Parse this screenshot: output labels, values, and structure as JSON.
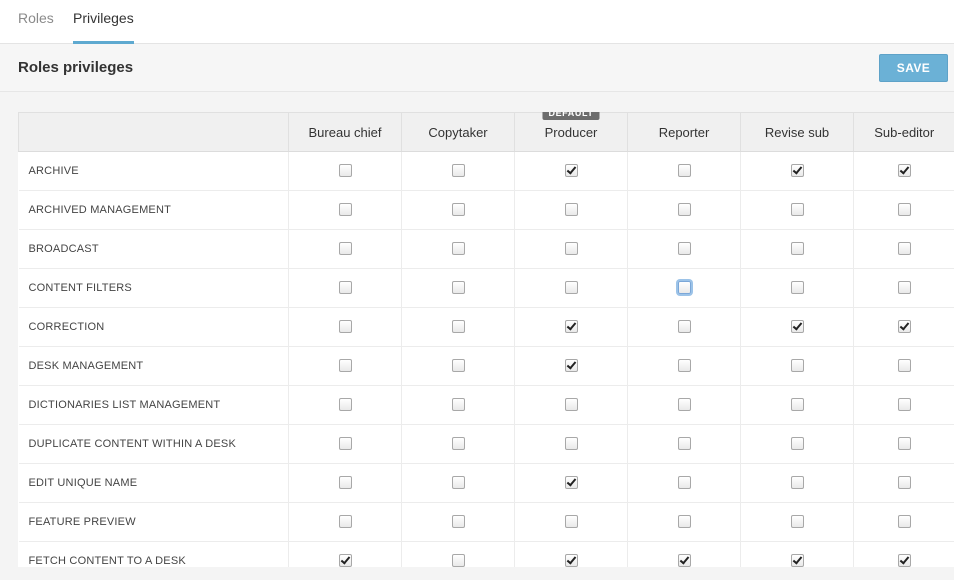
{
  "tabs": [
    {
      "label": "Roles",
      "active": false
    },
    {
      "label": "Privileges",
      "active": true
    }
  ],
  "toolbar": {
    "title": "Roles privileges",
    "save_label": "SAVE"
  },
  "colors": {
    "accent": "#5ea9d0",
    "save_button": "#6bb1d6",
    "badge": "#6d6d6d"
  },
  "table": {
    "default_badge": "DEFAULT",
    "default_role_index": 2,
    "roles": [
      "Bureau chief",
      "Copytaker",
      "Producer",
      "Reporter",
      "Revise sub",
      "Sub-editor"
    ],
    "rows": [
      {
        "name": "ARCHIVE",
        "values": [
          false,
          false,
          true,
          false,
          true,
          true
        ]
      },
      {
        "name": "ARCHIVED MANAGEMENT",
        "values": [
          false,
          false,
          false,
          false,
          false,
          false
        ]
      },
      {
        "name": "BROADCAST",
        "values": [
          false,
          false,
          false,
          false,
          false,
          false
        ]
      },
      {
        "name": "CONTENT FILTERS",
        "values": [
          false,
          false,
          false,
          false,
          false,
          false
        ],
        "focused_index": 3
      },
      {
        "name": "CORRECTION",
        "values": [
          false,
          false,
          true,
          false,
          true,
          true
        ]
      },
      {
        "name": "DESK MANAGEMENT",
        "values": [
          false,
          false,
          true,
          false,
          false,
          false
        ]
      },
      {
        "name": "DICTIONARIES LIST MANAGEMENT",
        "values": [
          false,
          false,
          false,
          false,
          false,
          false
        ]
      },
      {
        "name": "DUPLICATE CONTENT WITHIN A DESK",
        "values": [
          false,
          false,
          false,
          false,
          false,
          false
        ]
      },
      {
        "name": "EDIT UNIQUE NAME",
        "values": [
          false,
          false,
          true,
          false,
          false,
          false
        ]
      },
      {
        "name": "FEATURE PREVIEW",
        "values": [
          false,
          false,
          false,
          false,
          false,
          false
        ]
      },
      {
        "name": "FETCH CONTENT TO A DESK",
        "values": [
          true,
          false,
          true,
          true,
          true,
          true
        ]
      }
    ]
  }
}
